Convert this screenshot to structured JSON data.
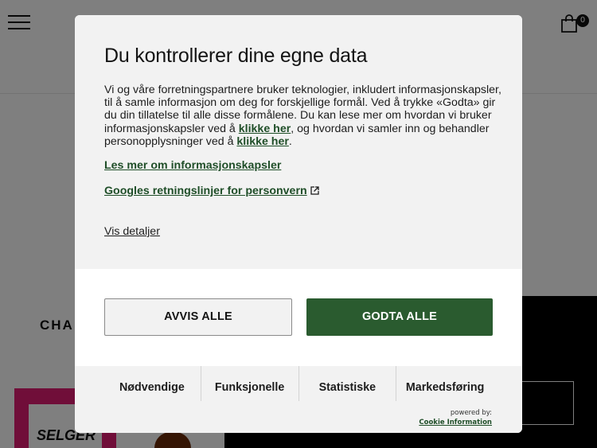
{
  "header": {
    "cart_count": "0"
  },
  "background": {
    "brand_text": "CHA",
    "badge_text": "SELGER"
  },
  "dialog": {
    "title": "Du kontrollerer dine egne data",
    "body_part1": "Vi og våre forretningspartnere bruker teknologier, inkludert informasjonskapsler, til å samle informasjon om deg for forskjellige formål. Ved å trykke «Godta» gir du din tillatelse til alle disse formålene. Du kan lese mer om hvordan vi bruker informasjonskapsler ved å ",
    "link_here_1": "klikke her",
    "body_part2": ", og hvordan vi samler inn og behandler personopplysninger ved å ",
    "link_here_2": "klikke her",
    "body_part3": ".",
    "cookies_link": "Les mer om informasjonskapsler",
    "google_link": "Googles retningslinjer for personvern",
    "show_details": "Vis detaljer",
    "reject_all": "AVVIS ALLE",
    "accept_all": "GODTA ALLE",
    "tabs": [
      "Nødvendige",
      "Funksjonelle",
      "Statistiske",
      "Markedsføring"
    ],
    "powered_by": "powered by:",
    "powered_link": "Cookie Information"
  },
  "colors": {
    "accent": "#2a5b2f",
    "link": "#1f4e28",
    "panel": "#f2f2f2",
    "overlay": "rgba(0,0,0,0.5)"
  },
  "icons": {
    "menu": "hamburger-icon",
    "cart": "shopping-bag-icon",
    "external": "external-link-icon"
  }
}
